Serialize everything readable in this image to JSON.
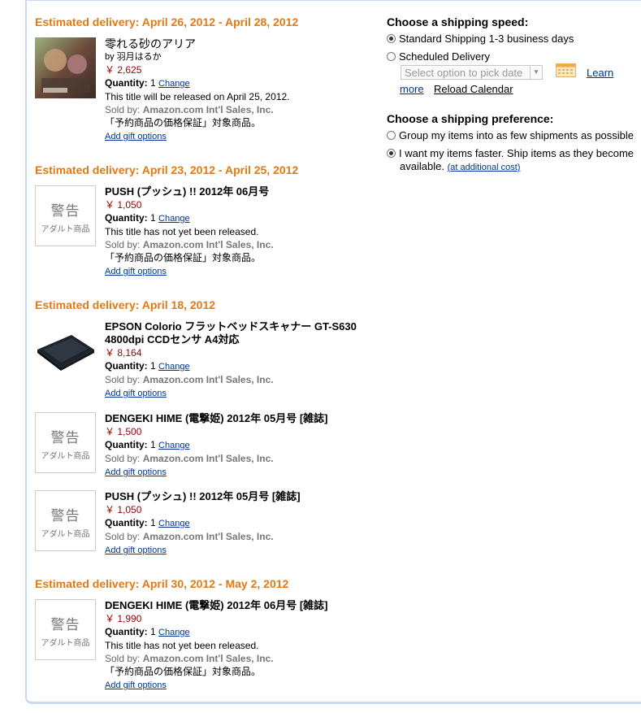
{
  "groups": [
    {
      "heading": "Estimated delivery: April 26, 2012 - April 28, 2012",
      "items": [
        {
          "title": "零れる砂のアリア",
          "author": "by 羽月はるか",
          "price": "￥ 2,625",
          "quantity_label": "Quantity:",
          "quantity": "1",
          "change": "Change",
          "release_note": "This title will be released on April 25, 2012.",
          "sold_by_label": "Sold by:",
          "sold_by": "Amazon.com Int'l Sales, Inc.",
          "guarantee": "「予約商品の価格保証」対象商品。",
          "gift": "Add gift options"
        }
      ]
    },
    {
      "heading": "Estimated delivery: April 23, 2012 - April 25, 2012",
      "items": [
        {
          "warning_big": "警告",
          "warning_small": "アダルト商品",
          "title": "PUSH (プッシュ) !! 2012年 06月号",
          "price": "￥ 1,050",
          "quantity_label": "Quantity:",
          "quantity": "1",
          "change": "Change",
          "release_note": "This title has not yet been released.",
          "sold_by_label": "Sold by:",
          "sold_by": "Amazon.com Int'l Sales, Inc.",
          "guarantee": "「予約商品の価格保証」対象商品。",
          "gift": "Add gift options"
        }
      ]
    },
    {
      "heading": "Estimated delivery: April 18, 2012",
      "items": [
        {
          "title": "EPSON Colorio フラットベッドスキャナー GT-S630 4800dpi CCDセンサ A4対応",
          "price": "￥ 8,164",
          "quantity_label": "Quantity:",
          "quantity": "1",
          "change": "Change",
          "sold_by_label": "Sold by:",
          "sold_by": "Amazon.com Int'l Sales, Inc.",
          "gift": "Add gift options"
        },
        {
          "warning_big": "警告",
          "warning_small": "アダルト商品",
          "title": "DENGEKI HIME (電撃姫) 2012年 05月号 [雑誌]",
          "price": "￥ 1,500",
          "quantity_label": "Quantity:",
          "quantity": "1",
          "change": "Change",
          "sold_by_label": "Sold by:",
          "sold_by": "Amazon.com Int'l Sales, Inc.",
          "gift": "Add gift options"
        },
        {
          "warning_big": "警告",
          "warning_small": "アダルト商品",
          "title": "PUSH (プッシュ) !! 2012年 05月号 [雑誌]",
          "price": "￥ 1,050",
          "quantity_label": "Quantity:",
          "quantity": "1",
          "change": "Change",
          "sold_by_label": "Sold by:",
          "sold_by": "Amazon.com Int'l Sales, Inc.",
          "gift": "Add gift options"
        }
      ]
    },
    {
      "heading": "Estimated delivery: April 30, 2012 - May 2, 2012",
      "items": [
        {
          "warning_big": "警告",
          "warning_small": "アダルト商品",
          "title": "DENGEKI HIME (電撃姫) 2012年 06月号 [雑誌]",
          "price": "￥ 1,990",
          "quantity_label": "Quantity:",
          "quantity": "1",
          "change": "Change",
          "release_note": "This title has not yet been released.",
          "sold_by_label": "Sold by:",
          "sold_by": "Amazon.com Int'l Sales, Inc.",
          "guarantee": "「予約商品の価格保証」対象商品。",
          "gift": "Add gift options"
        }
      ]
    }
  ],
  "shipping_speed": {
    "heading": "Choose a shipping speed:",
    "standard": "Standard Shipping 1-3 business days",
    "scheduled": "Scheduled Delivery",
    "select_placeholder": "Select option to pick date",
    "learn": "Learn",
    "more": "more",
    "reload": "Reload Calendar"
  },
  "shipping_preference": {
    "heading": "Choose a shipping preference:",
    "group": "Group my items into as few shipments as possible",
    "faster_line1": "I want my items faster. Ship items as they become",
    "faster_line2": "available.",
    "additional_cost": "(at additional cost)"
  },
  "colors": {
    "heading_orange": "#e47911",
    "price_red": "#990000",
    "link_blue": "#003399",
    "frame_blue": "#c9daf0"
  }
}
